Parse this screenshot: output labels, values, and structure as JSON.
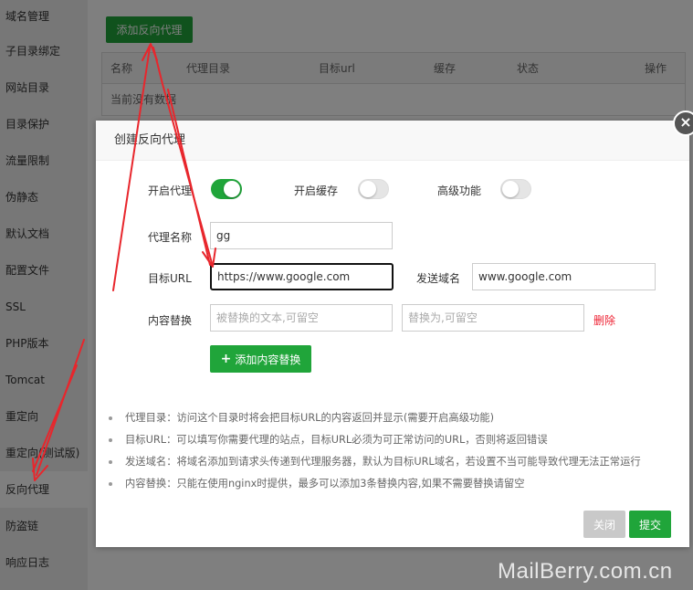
{
  "sidebar": {
    "items": [
      {
        "label": "域名管理"
      },
      {
        "label": "子目录绑定"
      },
      {
        "label": "网站目录"
      },
      {
        "label": "目录保护"
      },
      {
        "label": "流量限制"
      },
      {
        "label": "伪静态"
      },
      {
        "label": "默认文档"
      },
      {
        "label": "配置文件"
      },
      {
        "label": "SSL"
      },
      {
        "label": "PHP版本"
      },
      {
        "label": "Tomcat"
      },
      {
        "label": "重定向"
      },
      {
        "label": "重定向(测试版)"
      },
      {
        "label": "反向代理"
      },
      {
        "label": "防盗链"
      },
      {
        "label": "响应日志"
      }
    ],
    "active_index": 13
  },
  "main": {
    "add_proxy_label": "添加反向代理",
    "table": {
      "columns": [
        "名称",
        "代理目录",
        "目标url",
        "缓存",
        "状态",
        "操作"
      ],
      "empty_text": "当前没有数据"
    }
  },
  "dialog": {
    "title": "创建反向代理",
    "close_glyph": "×",
    "enable_proxy_label": "开启代理",
    "enable_proxy_on": true,
    "enable_cache_label": "开启缓存",
    "enable_cache_on": false,
    "advanced_label": "高级功能",
    "advanced_on": false,
    "proxy_name_label": "代理名称",
    "proxy_name_value": "gg",
    "target_url_label": "目标URL",
    "target_url_value": "https://www.google.com",
    "send_domain_label": "发送域名",
    "send_domain_value": "www.google.com",
    "content_replace_label": "内容替换",
    "replace_from_placeholder": "被替换的文本,可留空",
    "replace_to_placeholder": "替换为,可留空",
    "delete_label": "删除",
    "add_content_label": "添加内容替换",
    "notes": [
      "代理目录：访问这个目录时将会把目标URL的内容返回并显示(需要开启高级功能)",
      "目标URL：可以填写你需要代理的站点，目标URL必须为可正常访问的URL，否则将返回错误",
      "发送域名：将域名添加到请求头传递到代理服务器，默认为目标URL域名，若设置不当可能导致代理无法正常运行",
      "内容替换：只能在使用nginx时提供，最多可以添加3条替换内容,如果不需要替换请留空"
    ],
    "close_label": "关闭",
    "submit_label": "提交"
  },
  "watermark": "MailBerry.com.cn",
  "colors": {
    "accent": "#20a53a",
    "annotation": "#e8262c",
    "danger": "#e22233"
  }
}
